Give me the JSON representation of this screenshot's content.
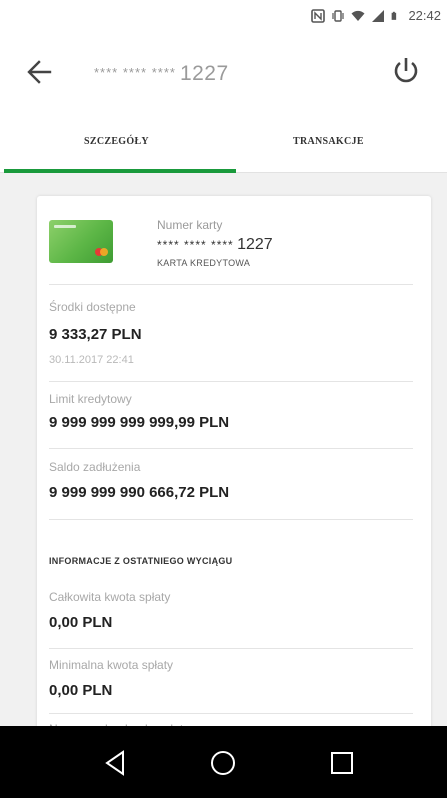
{
  "status_bar": {
    "time": "22:42",
    "icons": [
      "nfc-icon",
      "vibrate-icon",
      "wifi-icon",
      "signal-icon",
      "battery-icon"
    ]
  },
  "header": {
    "back_icon": "arrow-left-icon",
    "masked_prefix": "**** **** ****",
    "last_digits": "1227",
    "power_icon": "power-icon"
  },
  "tabs": [
    {
      "label": "SZCZEGÓŁY",
      "active": true
    },
    {
      "label": "TRANSAKCJE",
      "active": false
    }
  ],
  "colors": {
    "accent": "#1a9a3c",
    "background": "#f1f1f1"
  },
  "card": {
    "number_label": "Numer karty",
    "masked_prefix": "**** **** ****",
    "last_digits": "1227",
    "type": "KARTA KREDYTOWA"
  },
  "details": {
    "available": {
      "label": "Środki dostępne",
      "value": "9 333,27 PLN",
      "timestamp": "30.11.2017 22:41"
    },
    "credit_limit": {
      "label": "Limit kredytowy",
      "value": "9 999 999 999 999,99 PLN"
    },
    "debt_balance": {
      "label": "Saldo zadłużenia",
      "value": "9 999 999 990 666,72 PLN"
    }
  },
  "statement": {
    "title": "INFORMACJE Z OSTATNIEGO WYCIĄGU",
    "total": {
      "label": "Całkowita kwota spłaty",
      "value": "0,00 PLN"
    },
    "minimum": {
      "label": "Minimalna kwota spłaty",
      "value": "0,00 PLN"
    },
    "account_label": "Numer rachunku do spłaty"
  },
  "nav": [
    "nav-back-icon",
    "nav-home-icon",
    "nav-recents-icon"
  ]
}
